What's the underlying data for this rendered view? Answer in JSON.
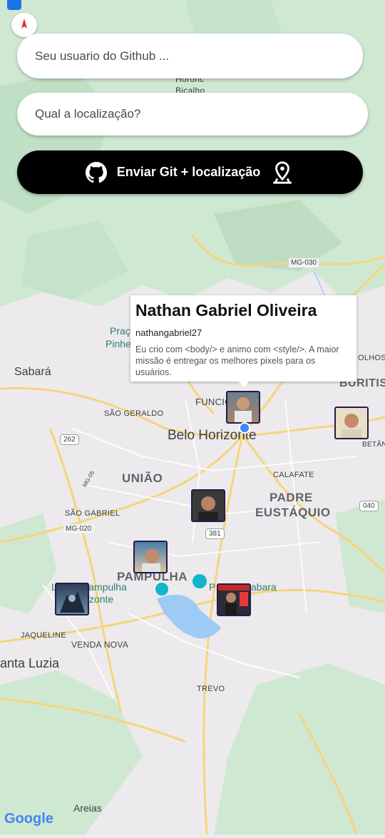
{
  "form": {
    "github_placeholder": "Seu usuario do Github ...",
    "location_placeholder": "Qual a localização?",
    "submit_label": "Enviar Git + localização",
    "github_icon": "github-icon",
    "location_icon": "map-pin-icon"
  },
  "popup": {
    "name": "Nathan Gabriel Oliveira",
    "username": "nathangabriel27",
    "bio": "Eu crio com <body/> e animo com <style/>. A maior missão é entregar os melhores pixels para os usuários."
  },
  "map_labels": {
    "hor1": "Horonc",
    "hor2": "Bicalho",
    "mg030": "MG-030",
    "praca1": "Praç",
    "praca2": "Pinhe",
    "sabara": "Sabará",
    "funcio": "FUNCIO",
    "buritis": "BURITIS",
    "olhos": "OLHOS D'",
    "sao_geraldo": "SÃO GERALDO",
    "belo_horizonte": "Belo Horizonte",
    "r262": "262",
    "uniao": "UNIÃO",
    "calafate": "CALAFATE",
    "betania": "BETÂN",
    "mg05": "MG-05",
    "padre": "PADRE",
    "eustaquio": "EUSTÁQUIO",
    "sao_gabriel": "SÃO GABRIEL",
    "r040": "040",
    "mg020": "MG-020",
    "r381": "381",
    "pampulha": "PAMPULHA",
    "lagoa1": "La    a Pampulha",
    "lagoa2": "    o Horizonte",
    "parque": "P    Guanabara",
    "jaqueline": "JAQUELINE",
    "venda_nova": "VENDA NOVA",
    "santa_luzia": "anta Luzia",
    "trevo": "TREVO",
    "areias": "Areias",
    "google": "Google"
  },
  "colors": {
    "map_bg": "#eceaec",
    "green": "#c8e6c9",
    "road": "#f7d774",
    "water": "#9ecaf6",
    "button_bg": "#000000",
    "avatar_border": "#251a4e",
    "location_dot": "#4285f4"
  },
  "avatars": [
    "user-avatar",
    "user-avatar",
    "user-avatar",
    "user-avatar",
    "user-avatar",
    "user-avatar"
  ]
}
